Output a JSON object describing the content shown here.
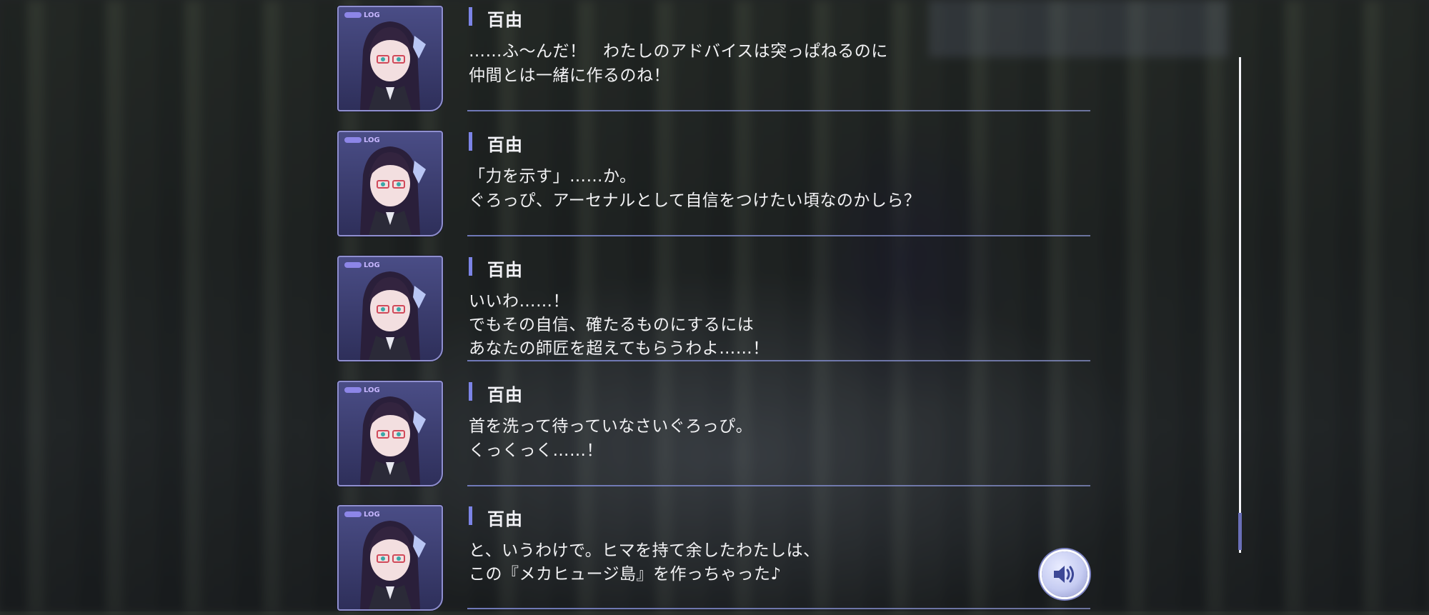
{
  "log": {
    "entries": [
      {
        "portrait_tag": "LOG",
        "speaker": "百由",
        "lines": [
          "……ふ〜んだ！　わたしのアドバイスは突っぱねるのに",
          "仲間とは一緒に作るのね！"
        ]
      },
      {
        "portrait_tag": "LOG",
        "speaker": "百由",
        "lines": [
          "「力を示す」……か。",
          "ぐろっぴ、アーセナルとして自信をつけたい頃なのかしら？"
        ]
      },
      {
        "portrait_tag": "LOG",
        "speaker": "百由",
        "lines": [
          "いいわ……！",
          "でもその自信、確たるものにするには",
          "あなたの師匠を超えてもらうわよ……！"
        ]
      },
      {
        "portrait_tag": "LOG",
        "speaker": "百由",
        "lines": [
          "首を洗って待っていなさいぐろっぴ。",
          "くっくっく……！"
        ]
      },
      {
        "portrait_tag": "LOG",
        "speaker": "百由",
        "lines": [
          "と、いうわけで。ヒマを持て余したわたしは、",
          "この『メカヒュージ島』を作っちゃった♪"
        ]
      }
    ]
  },
  "scrollbar": {
    "position_fraction": 0.95
  },
  "voice_button": {
    "icon": "speaker-icon"
  },
  "colors": {
    "accent": "#7c84e6",
    "text": "#f2f2f4",
    "separator": "#7882c8"
  }
}
